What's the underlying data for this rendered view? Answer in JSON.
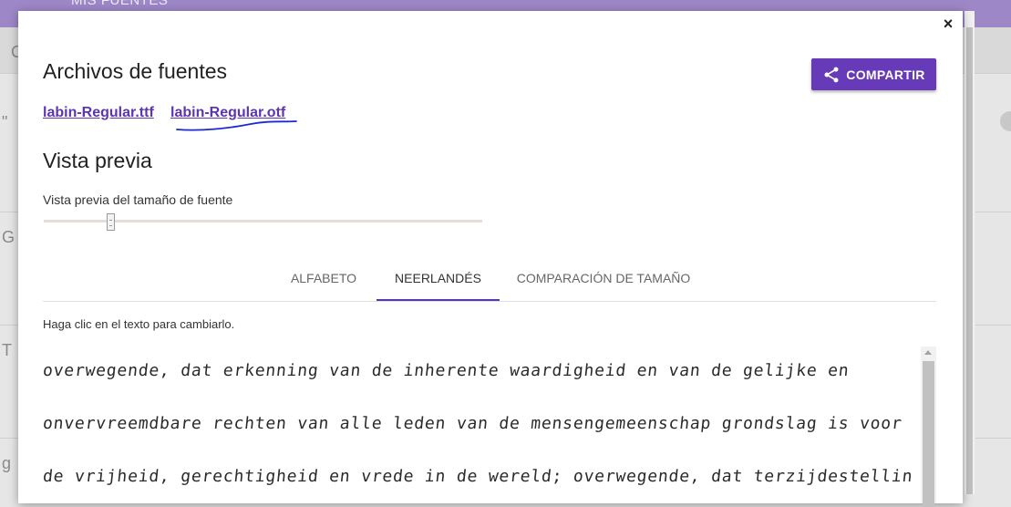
{
  "background": {
    "topbar_title": "MIS FUENTES",
    "left_letters": [
      "C",
      "\"",
      "G",
      "T",
      "g"
    ]
  },
  "modal": {
    "close_label": "×",
    "title": "Archivos de fuentes",
    "share_label": "COMPARTIR",
    "files": [
      "labin-Regular.ttf",
      "labin-Regular.otf"
    ],
    "preview_heading": "Vista previa",
    "slider_label": "Vista previa del tamaño de fuente",
    "slider_value_fraction": 0.15,
    "tabs": [
      "ALFABETO",
      "NEERLANDÉS",
      "COMPARACIÓN DE TAMAÑO"
    ],
    "active_tab": "NEERLANDÉS",
    "hint": "Haga clic en el texto para cambiarlo.",
    "preview_lines": [
      "overwegende, dat erkenning van de inherente waardigheid en van de gelijke en",
      "onvervreemdbare rechten van alle leden van de mensengemeenschap grondslag is voor",
      "de vrijheid, gerechtigheid en vrede in de wereld; overwegende, dat terzijdestelling"
    ]
  },
  "colors": {
    "accent": "#673ab7",
    "link": "#5e35b1",
    "topbar": "#9d87c7"
  },
  "icons": {
    "share": "share-icon",
    "close": "close-icon"
  }
}
